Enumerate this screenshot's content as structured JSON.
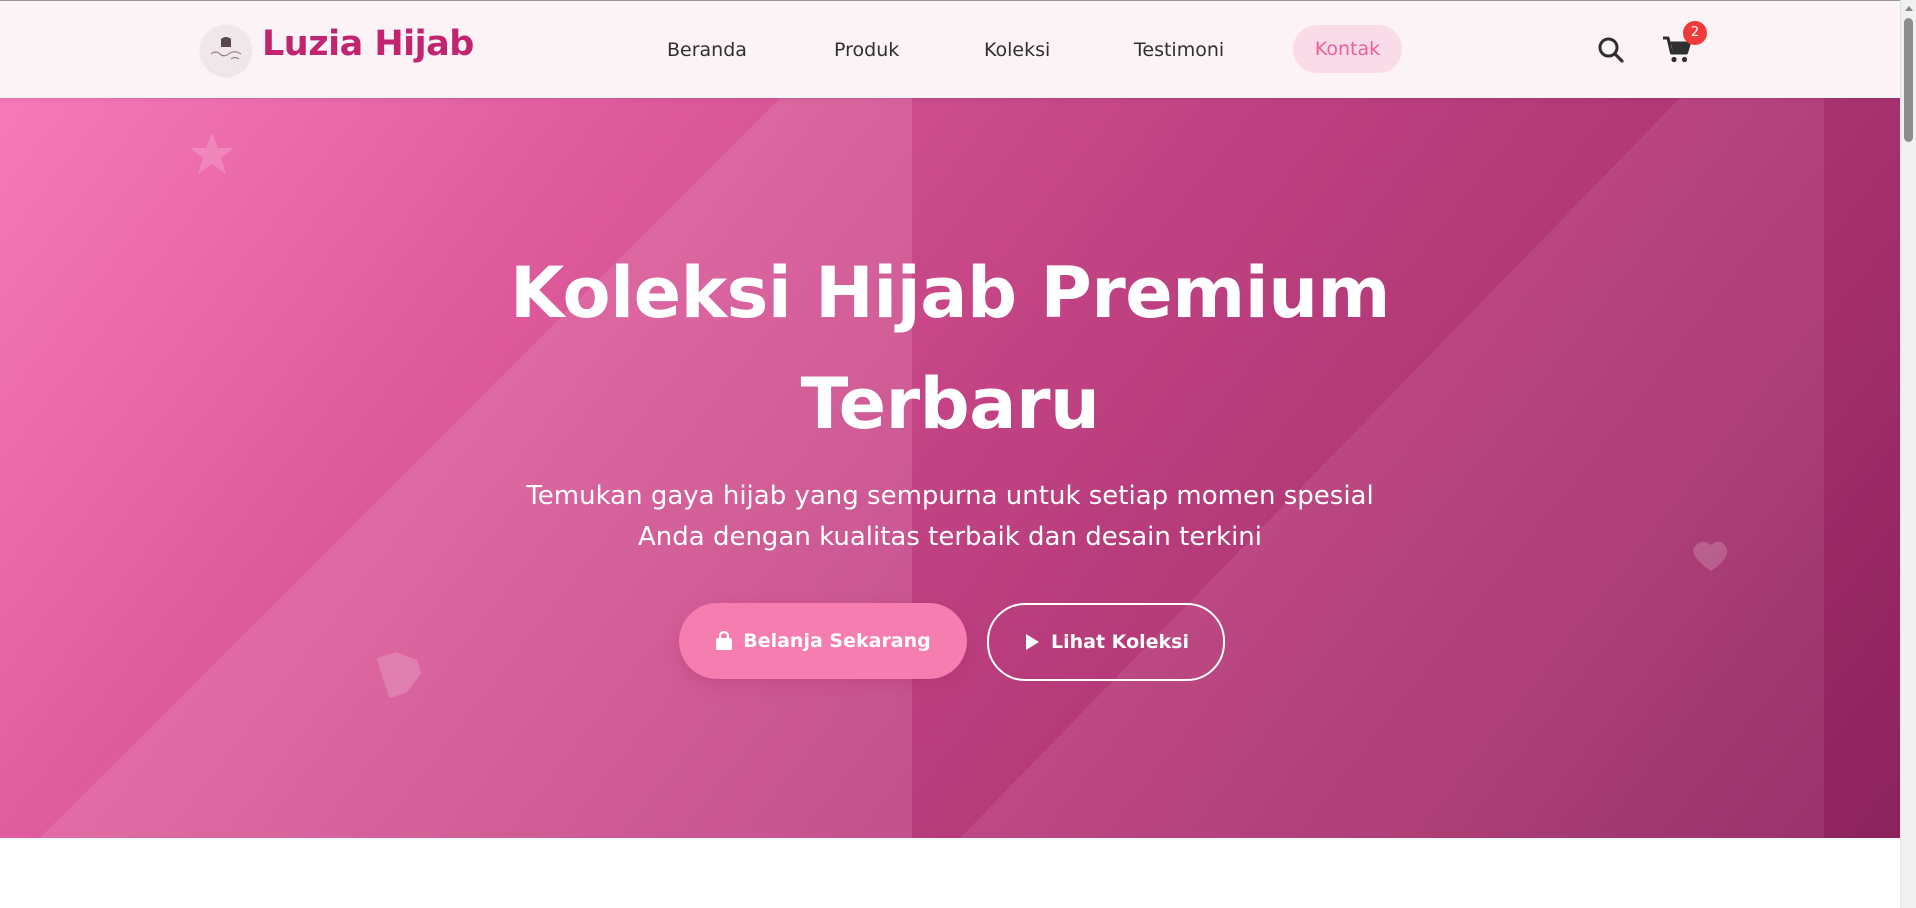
{
  "brand": {
    "name": "Luzia Hijab",
    "logo_text": "Luzia Hijab"
  },
  "nav": {
    "items": [
      "Beranda",
      "Produk",
      "Koleksi",
      "Testimoni"
    ],
    "contact": "Kontak"
  },
  "cart": {
    "count": "2"
  },
  "icons": {
    "search": "search-icon",
    "cart": "shopping-cart-icon",
    "bag": "shopping-bag-icon",
    "play": "play-icon"
  },
  "hero": {
    "title_line1": "Koleksi Hijab Premium",
    "title_line2": "Terbaru",
    "subtitle_line1": "Temukan gaya hijab yang sempurna untuk setiap momen spesial",
    "subtitle_line2": "Anda dengan kualitas terbaik dan desain terkini",
    "primary_cta": "Belanja Sekarang",
    "secondary_cta": "Lihat Koleksi"
  },
  "colors": {
    "brand": "#c2256f",
    "accent_pink": "#f57daf",
    "contact_bg": "#fadbe8",
    "badge": "#f13b3b",
    "hero_start": "#f779b8",
    "hero_end": "#8f2460"
  }
}
